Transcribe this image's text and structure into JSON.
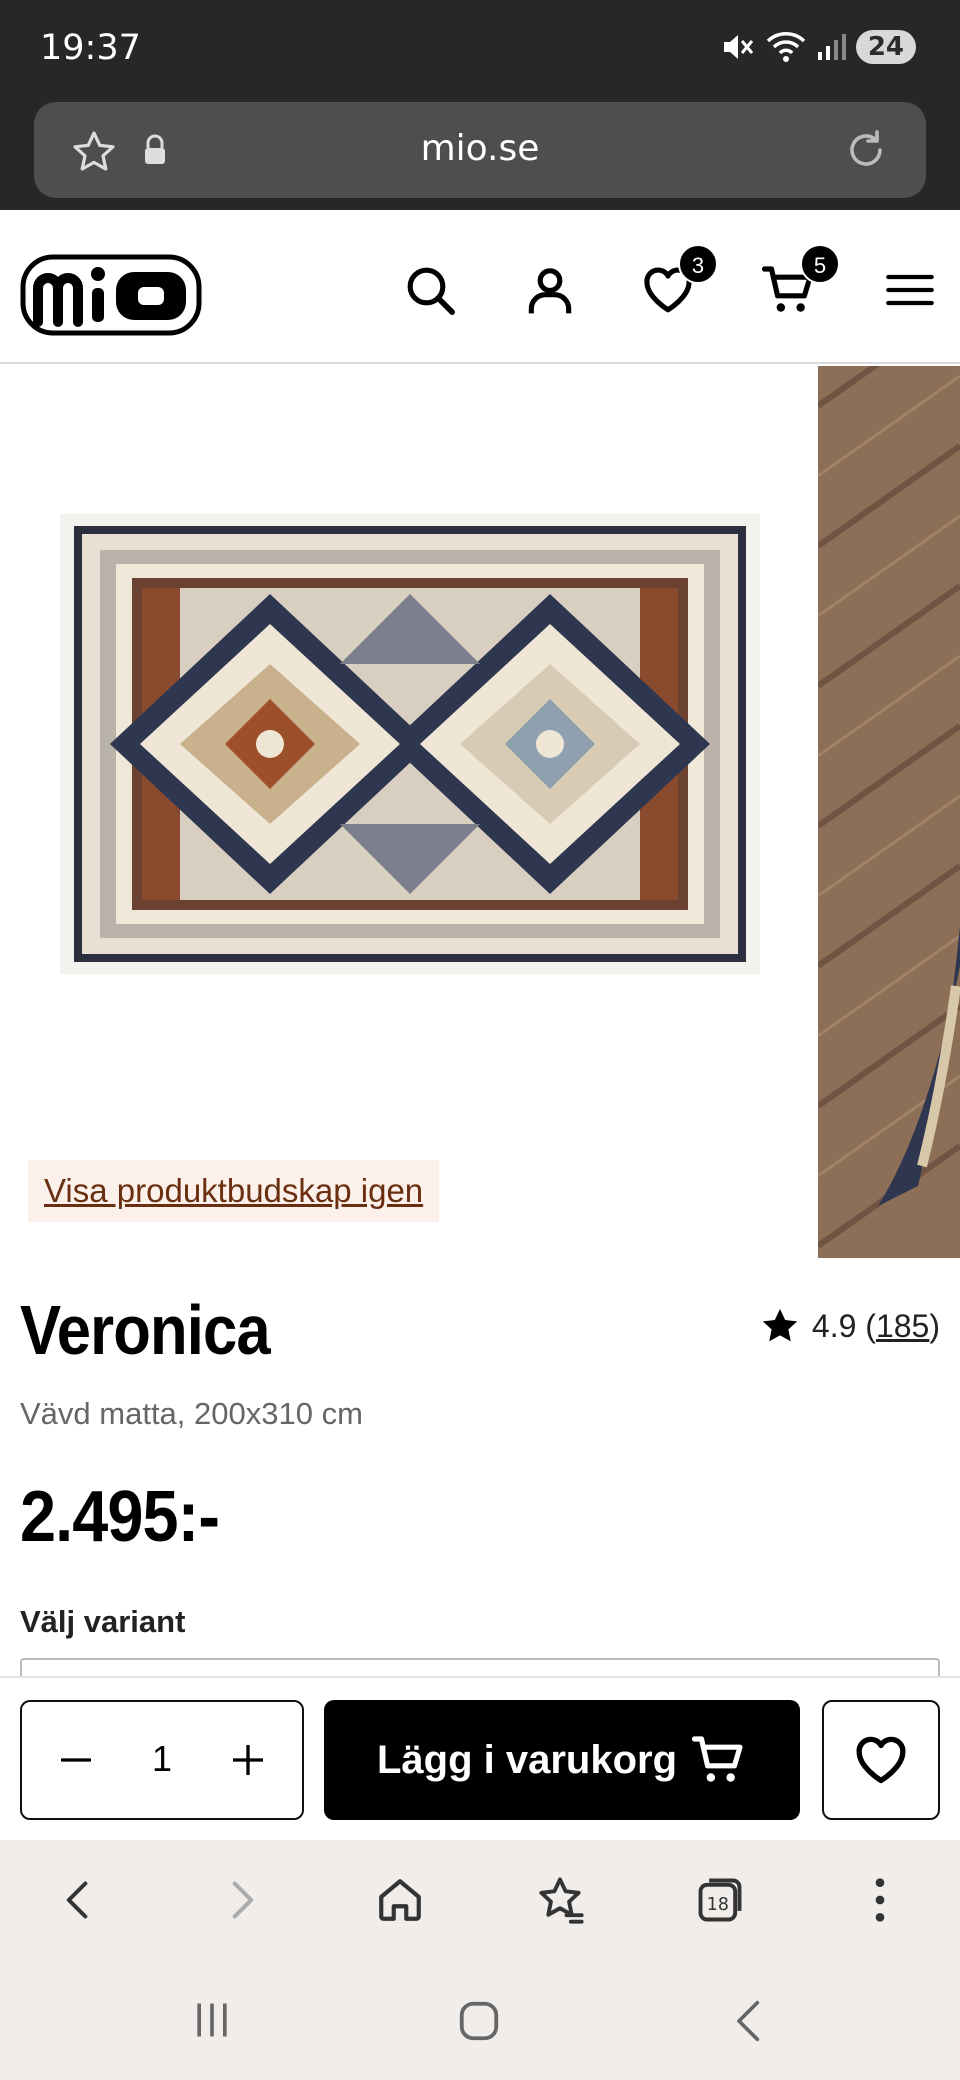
{
  "status": {
    "time": "19:37",
    "battery": "24"
  },
  "browser": {
    "url": "mio.se",
    "tab_count": "18"
  },
  "header": {
    "logo": "mio",
    "wishlist_count": "3",
    "cart_count": "5"
  },
  "gallery": {
    "message_link": "Visa produktbudskap igen"
  },
  "product": {
    "title": "Veronica",
    "rating": "4.9",
    "review_count": "185",
    "subtitle": "Vävd matta, 200x310 cm",
    "price": "2.495:-",
    "variant_label": "Välj variant"
  },
  "purchase": {
    "quantity": "1",
    "add_to_cart_label": "Lägg i varukorg"
  },
  "colors": {
    "status_bar": "#272727",
    "url_box": "#4e4e4e",
    "message_bg": "#fbf1ea",
    "message_text": "#6a2f10",
    "button_black": "#000000",
    "nav_bg": "#f0edea"
  }
}
